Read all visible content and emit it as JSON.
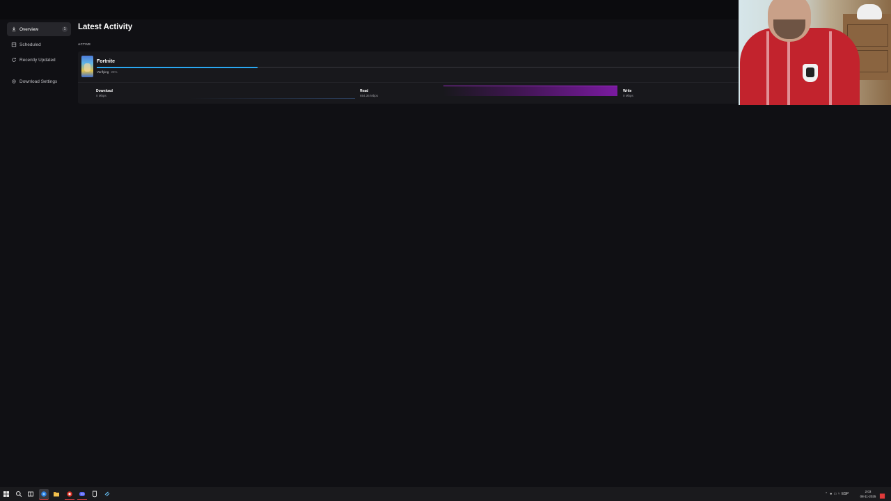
{
  "sidebar": {
    "items": [
      {
        "label": "Overview",
        "badge": "1",
        "icon": "download-icon",
        "active": true
      },
      {
        "label": "Scheduled",
        "icon": "calendar-icon"
      },
      {
        "label": "Recently Updated",
        "icon": "refresh-icon"
      },
      {
        "label": "Download Settings",
        "icon": "gear-icon"
      }
    ]
  },
  "main": {
    "title": "Latest Activity",
    "section_label": "ACTIVE",
    "active_item": {
      "name": "Fortnite",
      "status": "Verifying",
      "percent": "25%",
      "progress": 0.25
    },
    "stats": [
      {
        "label": "Download",
        "value": "0 Mbps"
      },
      {
        "label": "Read",
        "value": "654.36 Mbps"
      },
      {
        "label": "Write",
        "value": "0 Mbps"
      }
    ]
  },
  "taskbar": {
    "icons": [
      "windows-start-icon",
      "search-icon",
      "task-view-icon",
      "browser-icon",
      "chrome-icon",
      "file-explorer-icon",
      "discord-icon",
      "epic-games-icon",
      "steam-icon"
    ],
    "tray": {
      "language": "ESP"
    },
    "clock": {
      "time": "2:03",
      "date": "08-11-2025"
    }
  },
  "colors": {
    "background": "#101014",
    "progress_accent": "#2aa8f2",
    "read_graph": "#7a1aa0"
  }
}
